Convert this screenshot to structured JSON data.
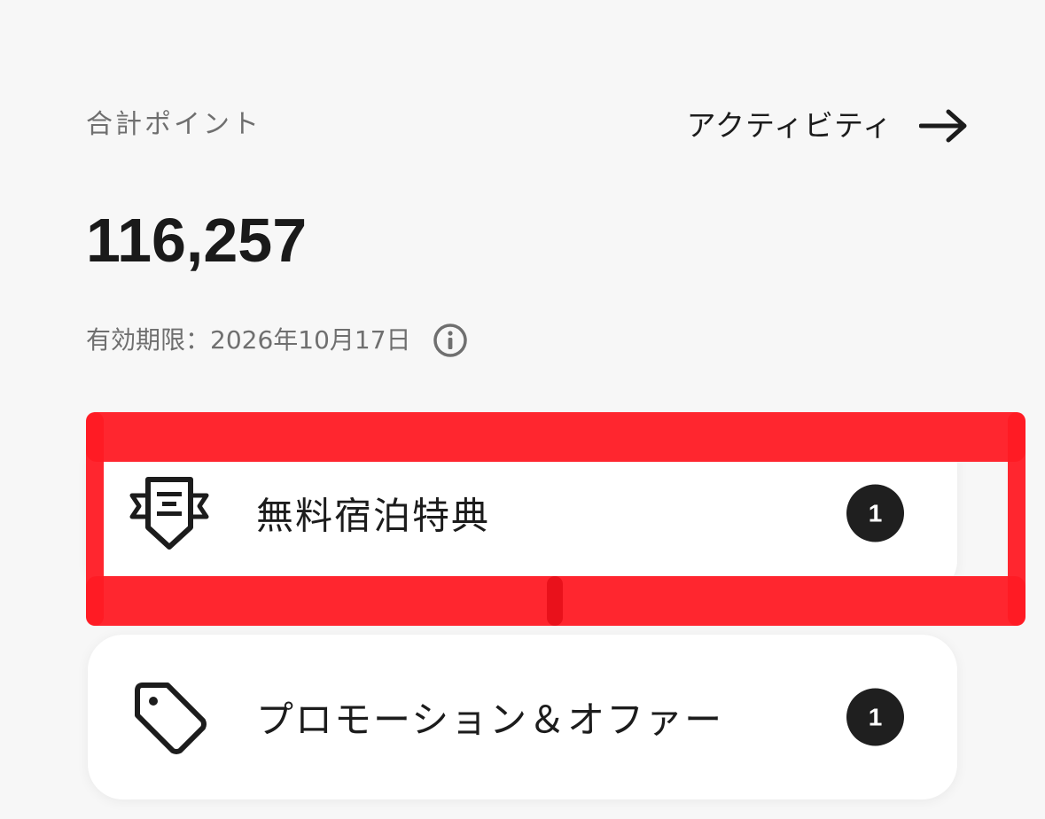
{
  "summary": {
    "total_points_label": "合計ポイント",
    "activity_label": "アクティビティ",
    "points_value": "116,257",
    "expiry_text": "有効期限：2026年10月17日"
  },
  "cards": [
    {
      "label": "無料宿泊特典",
      "count": "1",
      "icon": "ribbon-badge-icon"
    },
    {
      "label": "プロモーション＆オファー",
      "count": "1",
      "icon": "price-tag-icon"
    }
  ],
  "colors": {
    "background": "#f7f7f7",
    "card": "#ffffff",
    "badge": "#1f1f1f",
    "highlight": "#ff1a24",
    "muted_text": "#6f6f6f"
  }
}
